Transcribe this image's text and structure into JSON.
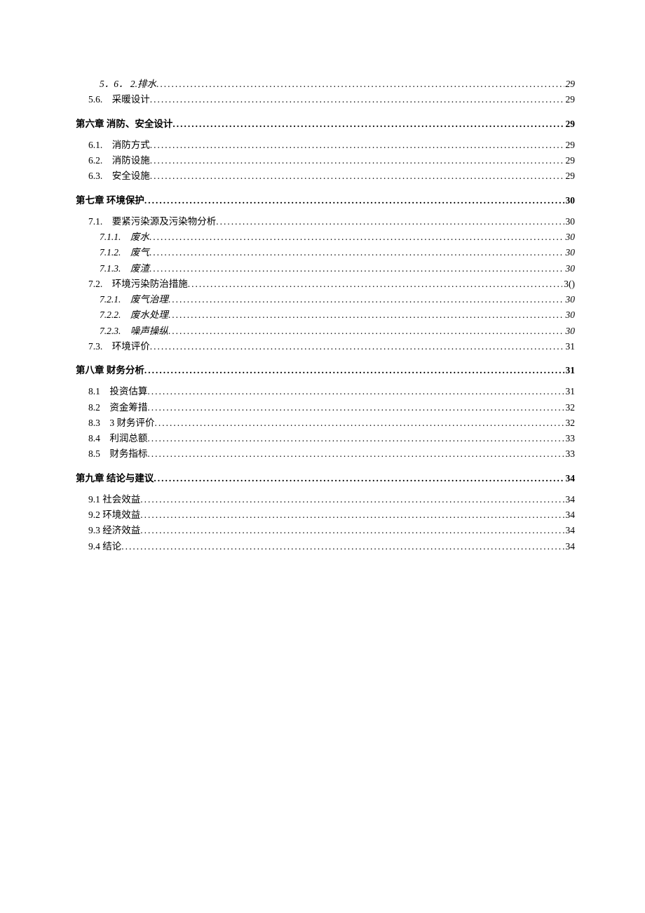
{
  "toc": [
    {
      "level": "lvl2",
      "label": "5．6． 2.排水",
      "page": "29"
    },
    {
      "level": "lvl1",
      "label": "5.6.　采暖设计",
      "page": "29"
    },
    {
      "level": "chapter",
      "label": "第六章 消防、安全设计",
      "page": "29"
    },
    {
      "level": "lvl1",
      "label": "6.1.　消防方式",
      "page": "29"
    },
    {
      "level": "lvl1",
      "label": "6.2.　消防设施",
      "page": "29"
    },
    {
      "level": "lvl1",
      "label": "6.3.　安全设施",
      "page": "29"
    },
    {
      "level": "chapter",
      "label": "第七章 环境保护",
      "page": "30"
    },
    {
      "level": "lvl1",
      "label": "7.1.　要紧污染源及污染物分析",
      "page": "30"
    },
    {
      "level": "lvl2",
      "label": "7.1.1.　废水",
      "page": "30"
    },
    {
      "level": "lvl2",
      "label": "7.1.2.　废气",
      "page": "30"
    },
    {
      "level": "lvl2",
      "label": "7.1.3.　废渣",
      "page": "30"
    },
    {
      "level": "lvl1",
      "label": "7.2.　环境污染防治措施",
      "page": "3()"
    },
    {
      "level": "lvl2",
      "label": "7.2.1.　废气治理",
      "page": "30"
    },
    {
      "level": "lvl2",
      "label": "7.2.2.　废水处理",
      "page": "30"
    },
    {
      "level": "lvl2",
      "label": "7.2.3.　噪声操纵",
      "page": "30"
    },
    {
      "level": "lvl1",
      "label": "7.3.　环境评价",
      "page": "31"
    },
    {
      "level": "chapter",
      "label": "第八章 财务分析",
      "page": "31"
    },
    {
      "level": "lvl1",
      "label": "8.1　投资估算",
      "page": "31"
    },
    {
      "level": "lvl1",
      "label": "8.2　资金筹措",
      "page": "32"
    },
    {
      "level": "lvl1",
      "label": "8.3　3 财务评价",
      "page": "32"
    },
    {
      "level": "lvl1",
      "label": "8.4　利润总额",
      "page": "33"
    },
    {
      "level": "lvl1",
      "label": "8.5　财务指标",
      "page": "33"
    },
    {
      "level": "chapter",
      "label": "第九章 结论与建议",
      "page": "34"
    },
    {
      "level": "lvl1",
      "label": "9.1 社会效益",
      "page": "34"
    },
    {
      "level": "lvl1",
      "label": "9.2 环境效益",
      "page": "34"
    },
    {
      "level": "lvl1",
      "label": "9.3 经济效益",
      "page": "34"
    },
    {
      "level": "lvl1",
      "label": "9.4 结论",
      "page": "34"
    }
  ]
}
